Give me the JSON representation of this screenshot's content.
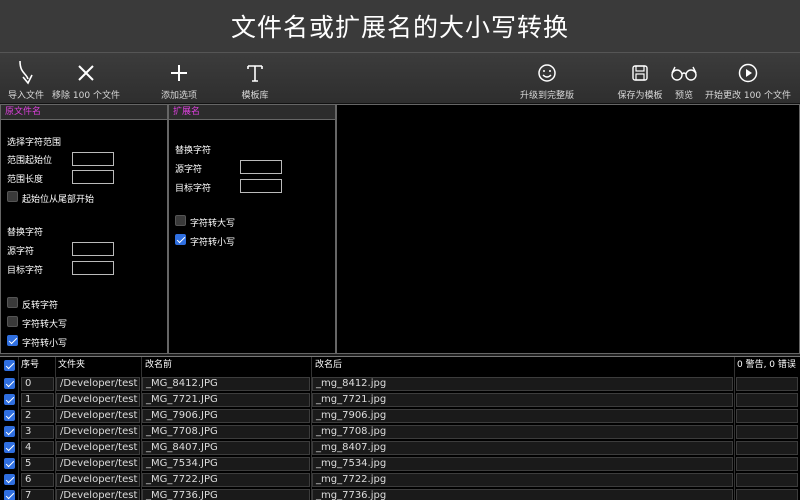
{
  "title": "文件名或扩展名的大小写转换",
  "toolbar": {
    "import": "导入文件",
    "remove": "移除 100 个文件",
    "add_option": "添加选项",
    "templates": "模板库",
    "upgrade": "升级到完整版",
    "save_template": "保存为模板",
    "preview": "预览",
    "start": "开始更改 100 个文件"
  },
  "left_panel": {
    "header": "原文件名",
    "range_title": "选择字符范围",
    "range_start": "范围起始位",
    "range_length": "范围长度",
    "from_end": "起始位从尾部开始",
    "replace_title": "替换字符",
    "source_char": "源字符",
    "target_char": "目标字符",
    "reverse": "反转字符",
    "to_upper": "字符转大写",
    "to_lower": "字符转小写",
    "from_end_checked": false,
    "reverse_checked": false,
    "to_upper_checked": false,
    "to_lower_checked": true
  },
  "ext_panel": {
    "header": "扩展名",
    "replace_title": "替换字符",
    "source_char": "源字符",
    "target_char": "目标字符",
    "to_upper": "字符转大写",
    "to_lower": "字符转小写",
    "to_upper_checked": false,
    "to_lower_checked": true
  },
  "table": {
    "columns": {
      "index": "序号",
      "folder": "文件夹",
      "before": "改名前",
      "after": "改名后",
      "status": "0 警告, 0 错误"
    },
    "rows": [
      {
        "index": "0",
        "folder": "/Developer/test",
        "before": "_MG_8412.JPG",
        "after": "_mg_8412.jpg"
      },
      {
        "index": "1",
        "folder": "/Developer/test",
        "before": "_MG_7721.JPG",
        "after": "_mg_7721.jpg"
      },
      {
        "index": "2",
        "folder": "/Developer/test",
        "before": "_MG_7906.JPG",
        "after": "_mg_7906.jpg"
      },
      {
        "index": "3",
        "folder": "/Developer/test",
        "before": "_MG_7708.JPG",
        "after": "_mg_7708.jpg"
      },
      {
        "index": "4",
        "folder": "/Developer/test",
        "before": "_MG_8407.JPG",
        "after": "_mg_8407.jpg"
      },
      {
        "index": "5",
        "folder": "/Developer/test",
        "before": "_MG_7534.JPG",
        "after": "_mg_7534.jpg"
      },
      {
        "index": "6",
        "folder": "/Developer/test",
        "before": "_MG_7722.JPG",
        "after": "_mg_7722.jpg"
      },
      {
        "index": "7",
        "folder": "/Developer/test",
        "before": "_MG_7736.JPG",
        "after": "_mg_7736.jpg"
      }
    ]
  },
  "colors": {
    "panel_header_text": "#e040e0",
    "checkbox_on": "#2f6fe0",
    "background": "#000000"
  }
}
